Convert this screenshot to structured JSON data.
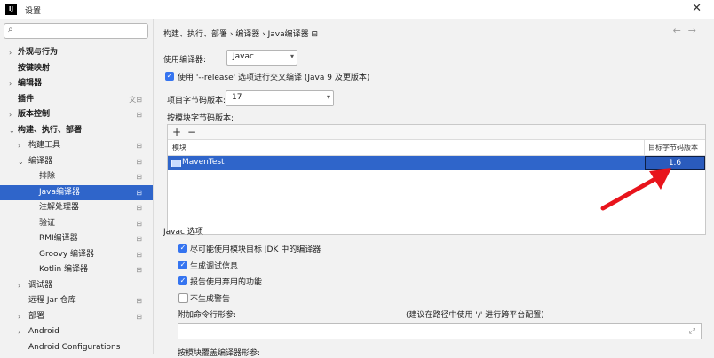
{
  "window": {
    "title": "设置",
    "app_icon_text": "IJ"
  },
  "sidebar": {
    "search_placeholder": "",
    "items": [
      {
        "label": "外观与行为",
        "arrow": "›",
        "bold": true,
        "indent": 0
      },
      {
        "label": "按键映射",
        "arrow": "",
        "bold": true,
        "indent": 0
      },
      {
        "label": "编辑器",
        "arrow": "›",
        "bold": true,
        "indent": 0
      },
      {
        "label": "插件",
        "arrow": "",
        "bold": true,
        "indent": 0,
        "badge": "文⊞"
      },
      {
        "label": "版本控制",
        "arrow": "›",
        "bold": true,
        "indent": 0,
        "badge": "⊟"
      },
      {
        "label": "构建、执行、部署",
        "arrow": "⌄",
        "bold": true,
        "indent": 0
      },
      {
        "label": "构建工具",
        "arrow": "›",
        "bold": false,
        "indent": 1,
        "badge": "⊟"
      },
      {
        "label": "编译器",
        "arrow": "⌄",
        "bold": false,
        "indent": 1,
        "badge": "⊟"
      },
      {
        "label": "排除",
        "arrow": "",
        "bold": false,
        "indent": 2,
        "badge": "⊟"
      },
      {
        "label": "Java编译器",
        "arrow": "",
        "bold": false,
        "indent": 2,
        "badge": "⊟",
        "selected": true
      },
      {
        "label": "注解处理器",
        "arrow": "",
        "bold": false,
        "indent": 2,
        "badge": "⊟"
      },
      {
        "label": "验证",
        "arrow": "",
        "bold": false,
        "indent": 2,
        "badge": "⊟"
      },
      {
        "label": "RMI编译器",
        "arrow": "",
        "bold": false,
        "indent": 2,
        "badge": "⊟"
      },
      {
        "label": "Groovy 编译器",
        "arrow": "",
        "bold": false,
        "indent": 2,
        "badge": "⊟"
      },
      {
        "label": "Kotlin 编译器",
        "arrow": "",
        "bold": false,
        "indent": 2,
        "badge": "⊟"
      },
      {
        "label": "调试器",
        "arrow": "›",
        "bold": false,
        "indent": 1
      },
      {
        "label": "远程 Jar 仓库",
        "arrow": "",
        "bold": false,
        "indent": 1,
        "badge": "⊟"
      },
      {
        "label": "部署",
        "arrow": "›",
        "bold": false,
        "indent": 1,
        "badge": "⊟"
      },
      {
        "label": "Android",
        "arrow": "›",
        "bold": false,
        "indent": 1
      },
      {
        "label": "Android Configurations",
        "arrow": "",
        "bold": false,
        "indent": 1
      }
    ]
  },
  "content": {
    "breadcrumb": "构建、执行、部署  ›  编译器  ›  Java编译器  ⊟",
    "nav_back": "←",
    "nav_forward": "→",
    "compiler_label": "使用编译器:",
    "compiler_value": "Javac",
    "release_option": "使用 '--release' 选项进行交叉编译 (Java 9 及更版本)",
    "bytecode_label": "项目字节码版本:",
    "bytecode_value": "17",
    "per_module_label": "按模块字节码版本:",
    "table": {
      "add": "+",
      "remove": "−",
      "col_module": "模块",
      "col_target": "目标字节码版本",
      "rows": [
        {
          "module": "MavenTest",
          "target": "1.6"
        }
      ]
    },
    "javac_section": "Javac 选项",
    "options": [
      {
        "label": "尽可能使用模块目标 JDK 中的编译器",
        "checked": true
      },
      {
        "label": "生成调试信息",
        "checked": true
      },
      {
        "label": "报告使用弃用的功能",
        "checked": true
      },
      {
        "label": "不生成警告",
        "checked": false
      }
    ],
    "extra_args_label": "附加命令行形参:",
    "extra_args_hint": "(建议在路径中使用 '/' 进行跨平台配置)",
    "override_label": "按模块覆盖编译器形参:"
  },
  "colors": {
    "accent": "#2f65ca",
    "arrow": "#e8141c",
    "checkbox": "#3574f0"
  }
}
